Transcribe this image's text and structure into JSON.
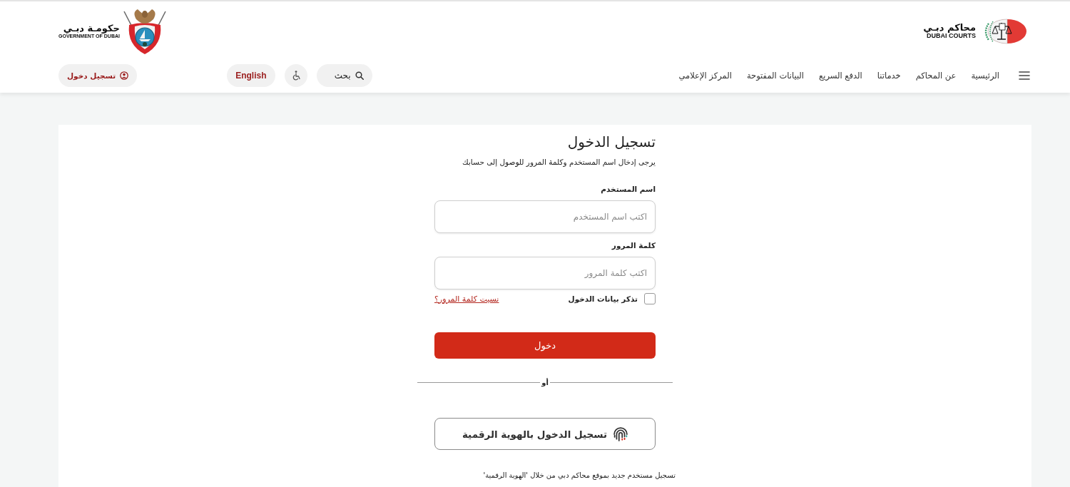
{
  "header": {
    "courts_logo": {
      "name_ar": "محاكم دبـي",
      "name_en": "DUBAI COURTS"
    },
    "government_logo": {
      "name_ar": "حكومـة دبـي",
      "name_en": "GOVERNMENT OF DUBAI"
    }
  },
  "nav": {
    "items": [
      "الرئيسية",
      "عن المحاكم",
      "خدماتنا",
      "الدفع السريع",
      "البيانات المفتوحة",
      "المركز الإعلامي"
    ]
  },
  "tools": {
    "search": {
      "placeholder": "بحث"
    },
    "language": "English",
    "login": "تسجيل دخول"
  },
  "login_form": {
    "title": "تسجيل الدخول",
    "subtitle": "يرجى إدخال اسم المستخدم وكلمة المرور للوصول إلى حسابك",
    "fields": [
      {
        "label": "اسم المستخدم",
        "placeholder": "اكتب اسم المستخدم"
      },
      {
        "label": "كلمة المرور",
        "placeholder": "اكتب كلمة المرور"
      }
    ],
    "remember": {
      "label": "تذكر بيانات الدخول",
      "checked": false
    },
    "forgot_link": "نسيت كلمة المرور؟",
    "submit": "دخول",
    "divider": "أو",
    "digital_id_button": "تسجيل الدخول بالهوية الرقمية",
    "register_note": "تسجيل مستخدم جديد بموقع محاكم دبي من خلال 'الهوية الرقمية'"
  }
}
